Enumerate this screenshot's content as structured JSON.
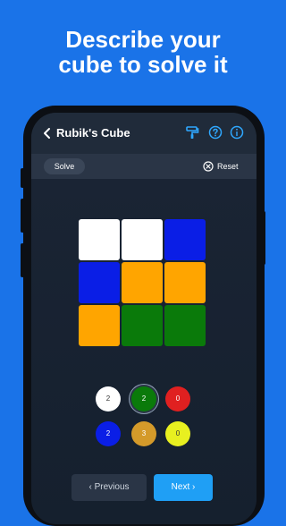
{
  "headline": {
    "line1": "Describe your",
    "line2": "cube to solve it"
  },
  "topbar": {
    "title": "Rubik's Cube",
    "icons": [
      "back-icon",
      "paint-roller-icon",
      "help-icon",
      "info-icon"
    ]
  },
  "subbar": {
    "solve_label": "Solve",
    "reset_label": "Reset"
  },
  "face": {
    "cells": [
      "#ffffff",
      "#ffffff",
      "#0a1ee6",
      "#0a1ee6",
      "#ffa500",
      "#ffa500",
      "#ffa500",
      "#0a7a0a",
      "#0a7a0a"
    ]
  },
  "palette": [
    {
      "color": "#ffffff",
      "count": "2",
      "text_color": "#333333"
    },
    {
      "color": "#0a7a0a",
      "count": "2",
      "text_color": "#ffffff"
    },
    {
      "color": "#e02020",
      "count": "0",
      "text_color": "#ffffff"
    },
    {
      "color": "#0a1ee6",
      "count": "2",
      "text_color": "#ffffff"
    },
    {
      "color": "#d49a2a",
      "count": "3",
      "text_color": "#ffffff"
    },
    {
      "color": "#e8f020",
      "count": "0",
      "text_color": "#333333"
    }
  ],
  "nav": {
    "previous_label": "‹  Previous",
    "next_label": "Next  ›"
  },
  "colors": {
    "background": "#1a73e8",
    "accent": "#1f9ff5"
  }
}
